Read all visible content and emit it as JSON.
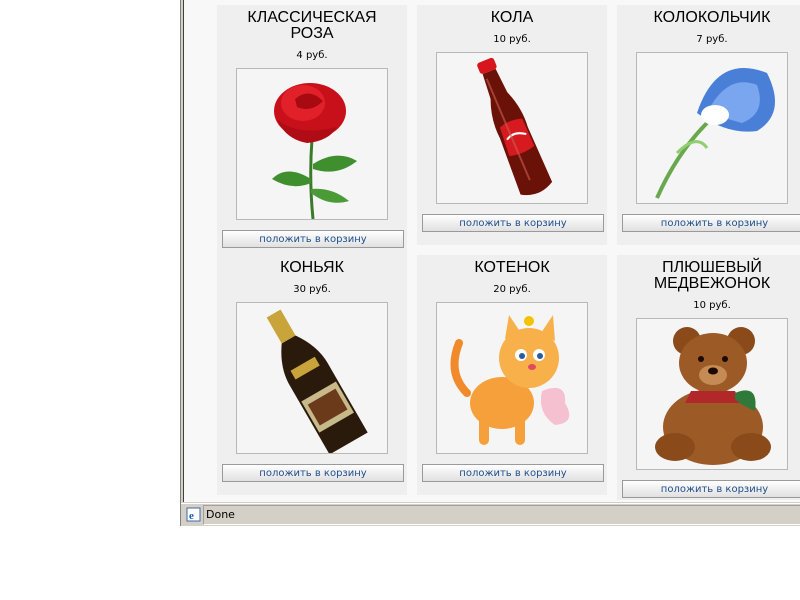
{
  "products": [
    {
      "title_line1": "КЛАССИЧЕСКАЯ",
      "title_line2": "РОЗА",
      "price": "4 руб.",
      "icon": "rose-image"
    },
    {
      "title_line1": "КОЛА",
      "title_line2": "",
      "price": "10 руб.",
      "icon": "cola-bottle-image"
    },
    {
      "title_line1": "КОЛОКОЛЬЧИК",
      "title_line2": "",
      "price": "7 руб.",
      "icon": "bluebell-flower-image"
    },
    {
      "title_line1": "КОНЬЯК",
      "title_line2": "",
      "price": "30 руб.",
      "icon": "cognac-bottle-image"
    },
    {
      "title_line1": "КОТЕНОК",
      "title_line2": "",
      "price": "20 руб.",
      "icon": "kitten-image"
    },
    {
      "title_line1": "ПЛЮШЕВЫЙ",
      "title_line2": "МЕДВЕЖОНОК",
      "price": "10 руб.",
      "icon": "teddy-bear-image"
    }
  ],
  "button_label": "положить в корзину",
  "statusbar": {
    "text": "Done",
    "icon": "ie-page-icon"
  },
  "colors": {
    "card_bg": "#efefef",
    "button_text": "#1f4e8c",
    "chrome": "#d4d0c8"
  }
}
